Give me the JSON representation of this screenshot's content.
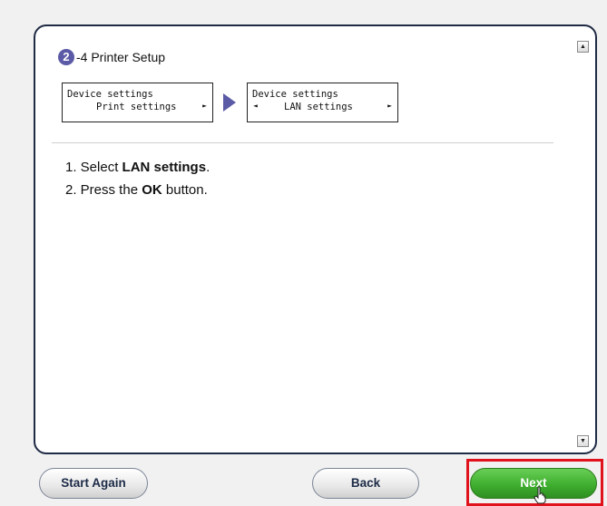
{
  "step": {
    "number": "2",
    "title": "-4 Printer Setup"
  },
  "lcd_screens": [
    {
      "line1": "Device settings",
      "line2": "Print settings",
      "right_arrow": "►",
      "left_arrow": ""
    },
    {
      "line1": "Device settings",
      "line2": "LAN settings",
      "right_arrow": "►",
      "left_arrow": "◄"
    }
  ],
  "instructions": [
    {
      "prefix": "1. Select ",
      "bold": "LAN settings",
      "suffix": "."
    },
    {
      "prefix": "2. Press the ",
      "bold": "OK",
      "suffix": " button."
    }
  ],
  "buttons": {
    "start_again": "Start Again",
    "back": "Back",
    "next": "Next"
  },
  "scrollbar": {
    "up_glyph": "▲",
    "down_glyph": "▼"
  },
  "colors": {
    "accent": "#5b5aa6",
    "next_green": "#3fae2f",
    "highlight_red": "#e0121b"
  }
}
